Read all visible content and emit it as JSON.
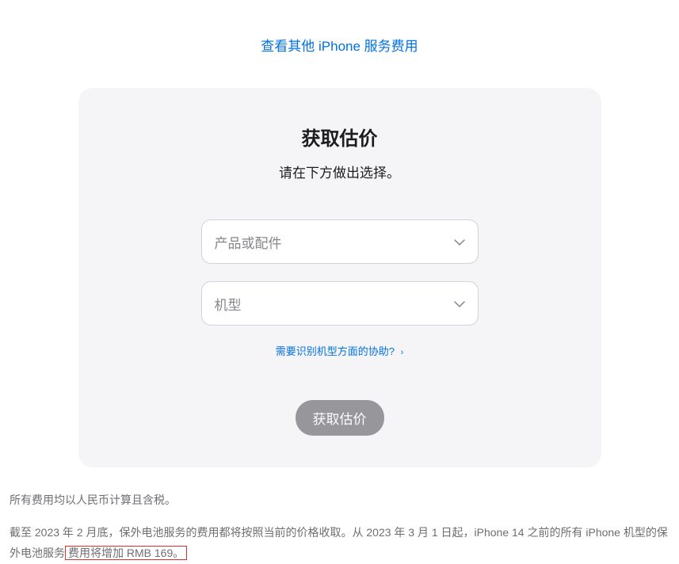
{
  "top_link": "查看其他 iPhone 服务费用",
  "card": {
    "title": "获取估价",
    "subtitle": "请在下方做出选择。",
    "select_product_placeholder": "产品或配件",
    "select_model_placeholder": "机型",
    "help_link": "需要识别机型方面的协助?",
    "submit_button": "获取估价"
  },
  "footer": {
    "line1": "所有费用均以人民币计算且含税。",
    "line2_part1": "截至 2023 年 2 月底，保外电池服务的费用都将按照当前的价格收取。从 2023 年 3 月 1 日起，iPhone 14 之前的所有 iPhone 机型的保外电池服务",
    "line2_highlight": "费用将增加 RMB 169。"
  }
}
